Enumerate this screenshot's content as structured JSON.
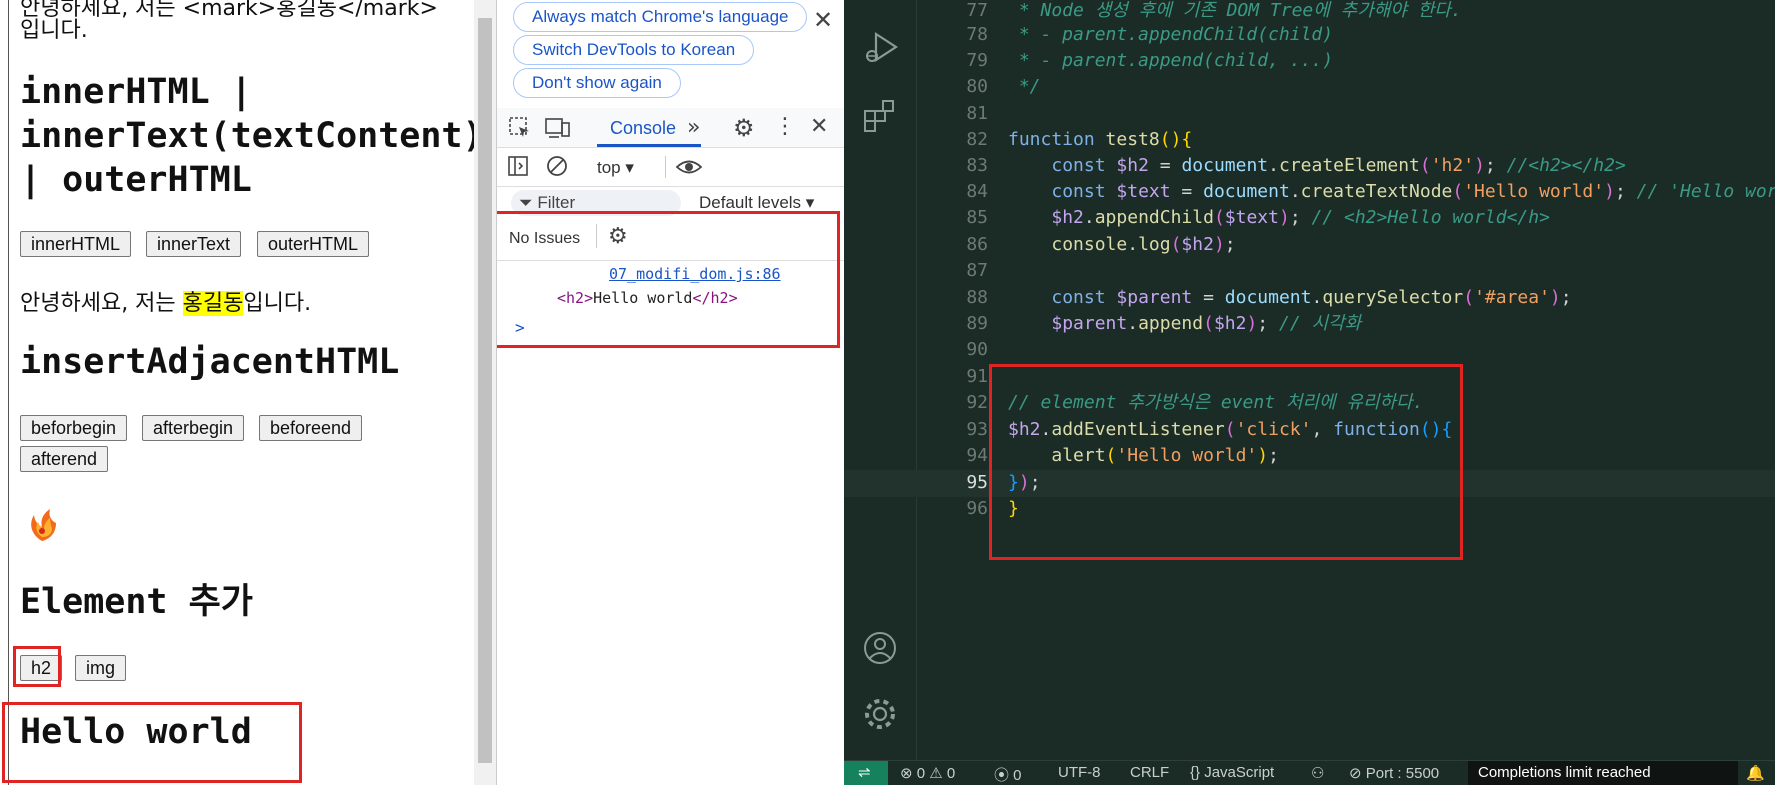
{
  "webpage": {
    "top_text_line1": "안녕하세요, 저는 <mark>홍길동</mark>입니다.",
    "top_text_line2": "입니다.",
    "heading_inner": "innerHTML | innerText(textContent) | outerHTML",
    "heading_inner_l1": "innerHTML |",
    "heading_inner_l2": "innerText(textContent)",
    "heading_inner_l3": "| outerHTML",
    "btn_innerHTML": "innerHTML",
    "btn_innerText": "innerText",
    "btn_outerHTML": "outerHTML",
    "greeting_before": "안녕하세요, 저는 ",
    "greeting_name": "홍길동",
    "greeting_after": "입니다.",
    "heading_insert": "insertAdjacentHTML",
    "btn_beforebegin": "beforbegin",
    "btn_afterbegin": "afterbegin",
    "btn_beforeend": "beforeend",
    "btn_afterend": "afterend",
    "heading_element": "Element 추가",
    "btn_h2": "h2",
    "btn_img": "img",
    "hello_heading": "Hello world"
  },
  "devtools": {
    "pill_match": "Always match Chrome's language",
    "pill_switch": "Switch DevTools to Korean",
    "pill_dont": "Don't show again",
    "tab_console": "Console",
    "context": "top",
    "filter_placeholder": "Filter",
    "levels": "Default levels",
    "no_issues": "No Issues",
    "log_source": "07_modifi_dom.js:86",
    "log_output_open": "<h2>",
    "log_output_text": "Hello world",
    "log_output_close": "</h2>",
    "prompt": ">"
  },
  "editor": {
    "line_numbers": [
      "77",
      "78",
      "79",
      "80",
      "81",
      "82",
      "83",
      "84",
      "85",
      "86",
      "87",
      "88",
      "89",
      "90",
      "91",
      "92",
      "93",
      "94",
      "95",
      "96"
    ],
    "current_line": "95",
    "status": {
      "errors": "0",
      "warnings": "0",
      "ports": "0",
      "encoding": "UTF-8",
      "eol": "CRLF",
      "language": "JavaScript",
      "port": "Port : 5500",
      "completions": "Completions limit reached"
    }
  },
  "colors": {
    "highlight_box": "#e02424",
    "mark": "#ffff00",
    "editor_bg": "#1b2b26",
    "link_blue": "#1a55c8"
  }
}
